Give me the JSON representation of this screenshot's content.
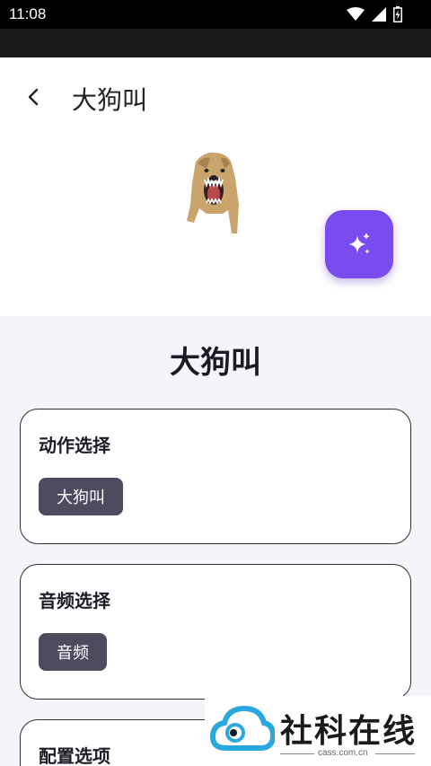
{
  "status_bar": {
    "time": "11:08"
  },
  "app_bar": {
    "title": "大狗叫"
  },
  "hero": {
    "image_alt": "dog"
  },
  "content": {
    "heading": "大狗叫",
    "cards": [
      {
        "title": "动作选择",
        "chip": "大狗叫"
      },
      {
        "title": "音频选择",
        "chip": "音频"
      },
      {
        "title": "配置选项"
      }
    ]
  },
  "watermark": {
    "text": "社科在线",
    "domain": "cass.com.cn"
  },
  "colors": {
    "accent": "#7a4cf0",
    "chip": "#4e4b5e",
    "background": "#f4f5f8"
  }
}
